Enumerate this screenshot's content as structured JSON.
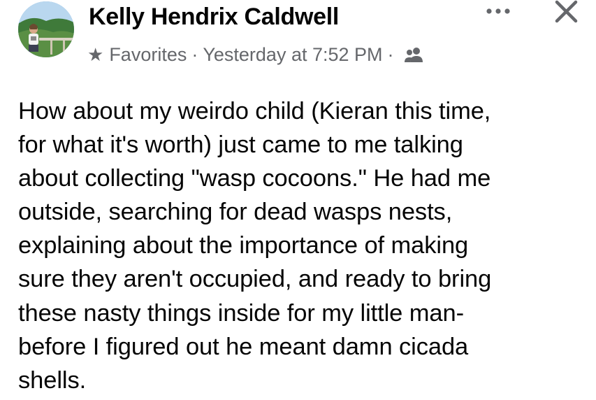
{
  "post": {
    "author_name": "Kelly Hendrix Caldwell",
    "meta": {
      "favorites_icon": "star-icon",
      "favorites_label": "Favorites",
      "separator": "·",
      "timestamp": "Yesterday at 7:52 PM",
      "separator2": "·",
      "audience_icon": "friends-icon"
    },
    "actions": {
      "more_icon": "more-options-icon",
      "close_icon": "close-icon"
    },
    "body_text": "How about my weirdo child (Kieran this time,\nfor what it's worth) just came to me talking\nabout collecting \"wasp cocoons.\" He had me\noutside, searching for dead wasps nests,\nexplaining about the importance of making\nsure they aren't occupied, and ready to bring\nthese nasty things inside for my little man-\nbefore I figured out he meant damn cicada\nshells."
  },
  "colors": {
    "primary_text": "#050505",
    "secondary_text": "#65676b",
    "background": "#ffffff"
  }
}
